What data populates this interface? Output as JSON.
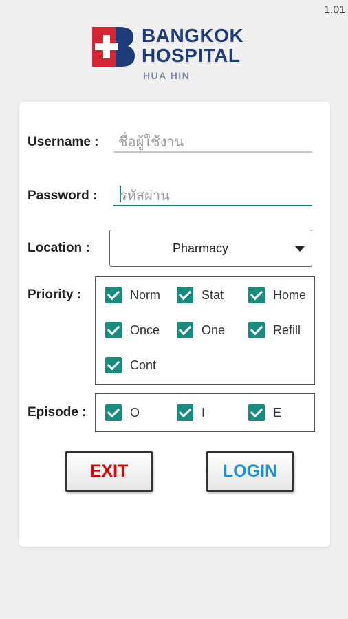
{
  "version": "1.01",
  "logo": {
    "line1": "BANGKOK",
    "line2": "HOSPITAL",
    "line3": "HUA HIN"
  },
  "form": {
    "username_label": "Username :",
    "username_placeholder": "ชื่อผู้ใช้งาน",
    "password_label": "Password :",
    "password_placeholder": "รหัสผ่าน",
    "location_label": "Location :",
    "location_value": "Pharmacy",
    "priority_label": "Priority :",
    "priority": [
      {
        "label": "Norm",
        "checked": true
      },
      {
        "label": "Stat",
        "checked": true
      },
      {
        "label": "Home",
        "checked": true
      },
      {
        "label": "Once",
        "checked": true
      },
      {
        "label": "One",
        "checked": true
      },
      {
        "label": "Refill",
        "checked": true
      },
      {
        "label": "Cont",
        "checked": true
      }
    ],
    "episode_label": "Episode :",
    "episode": [
      {
        "label": "O",
        "checked": true
      },
      {
        "label": "I",
        "checked": true
      },
      {
        "label": "E",
        "checked": true
      }
    ]
  },
  "buttons": {
    "exit": "EXIT",
    "login": "LOGIN"
  },
  "colors": {
    "accent": "#1c8b7f",
    "exit": "#e00000",
    "login": "#1e90d8",
    "brand_blue": "#1f3c7a",
    "brand_red": "#d62631"
  }
}
